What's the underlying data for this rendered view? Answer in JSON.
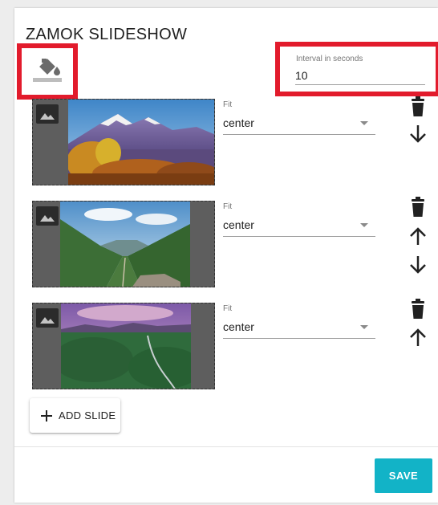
{
  "header": {
    "title": "ZAMOK SLIDESHOW"
  },
  "interval": {
    "label": "Interval in seconds",
    "value": "10"
  },
  "slides": [
    {
      "fit_label": "Fit",
      "fit_value": "center",
      "controls": [
        "delete-icon",
        "arrow-down-icon"
      ]
    },
    {
      "fit_label": "Fit",
      "fit_value": "center",
      "controls": [
        "delete-icon",
        "arrow-up-icon",
        "arrow-down-icon"
      ]
    },
    {
      "fit_label": "Fit",
      "fit_value": "center",
      "controls": [
        "delete-icon",
        "arrow-up-icon"
      ]
    }
  ],
  "actions": {
    "add_slide_label": "ADD SLIDE",
    "save_label": "SAVE"
  },
  "colors": {
    "accent": "#12b3c7",
    "highlight": "#e21b2c",
    "slide_background": "#5e5e5e"
  }
}
